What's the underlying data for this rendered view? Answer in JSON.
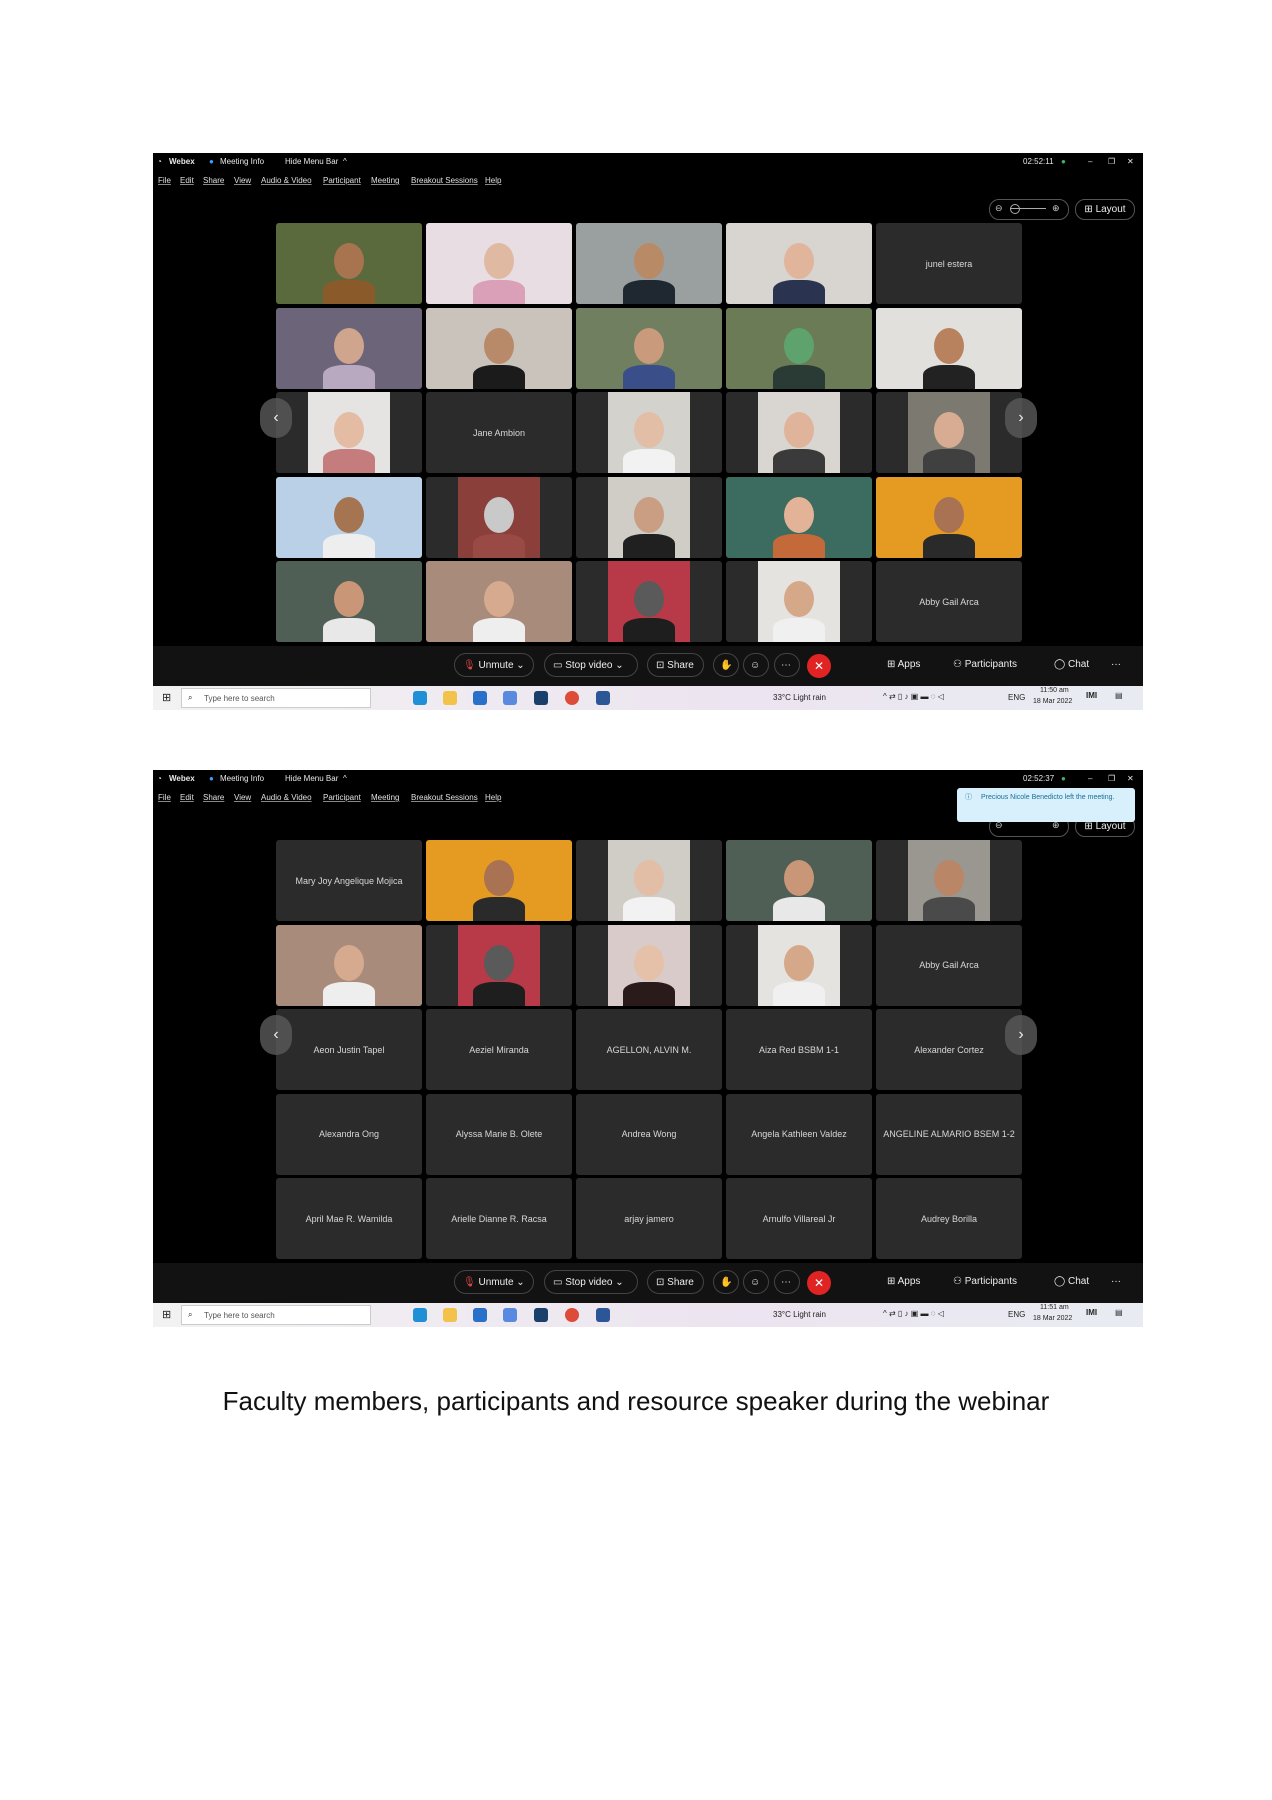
{
  "caption": "Faculty members, participants and resource speaker during the webinar",
  "screens": [
    {
      "title": {
        "app": "Webex",
        "meeting_info": "Meeting Info",
        "hide_menu": "Hide Menu Bar",
        "timer": "02:52:11"
      },
      "menu": [
        "File",
        "Edit",
        "Share",
        "View",
        "Audio & Video",
        "Participant",
        "Meeting",
        "Breakout Sessions",
        "Help"
      ],
      "layout_label": "Layout",
      "toolbar": {
        "unmute": "Unmute",
        "stop_video": "Stop video",
        "share": "Share",
        "apps": "Apps",
        "participants": "Participants",
        "chat": "Chat",
        "more": "···"
      },
      "taskbar": {
        "search_placeholder": "Type here to search",
        "weather": "33°C  Light rain",
        "lang": "ENG",
        "time": "11:50 am",
        "date": "18 Mar 2022"
      },
      "tiles": [
        {
          "kind": "video",
          "bg": "#5b6a3c",
          "skin": "#a7744f",
          "shirt": "#8b5a2b"
        },
        {
          "kind": "video",
          "bg": "#e8dde2",
          "skin": "#e0b9a3",
          "shirt": "#d9a0b8"
        },
        {
          "kind": "video",
          "bg": "#9aa0a0",
          "skin": "#b98a66",
          "shirt": "#1f2730"
        },
        {
          "kind": "video",
          "bg": "#d8d4d0",
          "skin": "#e1b59c",
          "shirt": "#2a3350"
        },
        {
          "kind": "name",
          "name": "junel estera"
        },
        {
          "kind": "video",
          "bg": "#6c6478",
          "skin": "#d0a58d",
          "shirt": "#b8a8c0"
        },
        {
          "kind": "video",
          "bg": "#c9c3bc",
          "skin": "#b88a6a",
          "shirt": "#1b1b1b"
        },
        {
          "kind": "video",
          "bg": "#6f7f60",
          "skin": "#c99a7b",
          "shirt": "#3a4f8a"
        },
        {
          "kind": "video",
          "bg": "#6a7b55",
          "skin": "#5ea36d",
          "shirt": "#2a3a35"
        },
        {
          "kind": "video",
          "bg": "#e2e0dc",
          "skin": "#b8825f",
          "shirt": "#222222"
        },
        {
          "kind": "portrait",
          "bg": "#e6e4e2",
          "skin": "#e4bca3",
          "shirt": "#c47c7c"
        },
        {
          "kind": "name",
          "name": "Jane Ambion"
        },
        {
          "kind": "portrait",
          "bg": "#d4d2cc",
          "skin": "#e2bea6",
          "shirt": "#f2f2f2"
        },
        {
          "kind": "portrait",
          "bg": "#d9d6d2",
          "skin": "#e0b49a",
          "shirt": "#3a3a3a"
        },
        {
          "kind": "portrait",
          "bg": "#7c7a70",
          "skin": "#d7ac92",
          "shirt": "#404040"
        },
        {
          "kind": "video",
          "bg": "#b9d0e6",
          "skin": "#a57552",
          "shirt": "#eeeeee"
        },
        {
          "kind": "portrait",
          "bg": "#8a3f3a",
          "skin": "#c9c9c9",
          "shirt": "#9a4a44"
        },
        {
          "kind": "portrait",
          "bg": "#d0ccc6",
          "skin": "#c99e83",
          "shirt": "#202020"
        },
        {
          "kind": "video",
          "bg": "#3c6b60",
          "skin": "#e3b397",
          "shirt": "#c46a3a"
        },
        {
          "kind": "video",
          "bg": "#e59a22",
          "skin": "#a87253",
          "shirt": "#2a2a2a"
        },
        {
          "kind": "video",
          "bg": "#4f5f55",
          "skin": "#c99777",
          "shirt": "#e8e8e8"
        },
        {
          "kind": "video",
          "bg": "#a88b7a",
          "skin": "#d5aa8e",
          "shirt": "#eeeeee"
        },
        {
          "kind": "portrait",
          "bg": "#b83a48",
          "skin": "#5a5a5a",
          "shirt": "#1e1e1e"
        },
        {
          "kind": "portrait",
          "bg": "#e5e3df",
          "skin": "#d6a88a",
          "shirt": "#f0f0f0"
        },
        {
          "kind": "name",
          "name": "Abby Gail Arca"
        }
      ]
    },
    {
      "title": {
        "app": "Webex",
        "meeting_info": "Meeting Info",
        "hide_menu": "Hide Menu Bar",
        "timer": "02:52:37"
      },
      "menu": [
        "File",
        "Edit",
        "Share",
        "View",
        "Audio & Video",
        "Participant",
        "Meeting",
        "Breakout Sessions",
        "Help"
      ],
      "layout_label": "Layout",
      "toast": "Precious Nicole Benedicto left the meeting.",
      "toolbar": {
        "unmute": "Unmute",
        "stop_video": "Stop video",
        "share": "Share",
        "apps": "Apps",
        "participants": "Participants",
        "chat": "Chat",
        "more": "···"
      },
      "taskbar": {
        "search_placeholder": "Type here to search",
        "weather": "33°C  Light rain",
        "lang": "ENG",
        "time": "11:51 am",
        "date": "18 Mar 2022"
      },
      "tiles": [
        {
          "kind": "name",
          "name": "Mary Joy Angelique Mojica"
        },
        {
          "kind": "video",
          "bg": "#e59a22",
          "skin": "#a87253",
          "shirt": "#2a2a2a"
        },
        {
          "kind": "portrait",
          "bg": "#d0ccc6",
          "skin": "#e2bea6",
          "shirt": "#f2f2f2"
        },
        {
          "kind": "video",
          "bg": "#4f5f55",
          "skin": "#c99777",
          "shirt": "#e8e8e8"
        },
        {
          "kind": "portrait",
          "bg": "#9a9690",
          "skin": "#b98668",
          "shirt": "#4a4a4a"
        },
        {
          "kind": "video",
          "bg": "#a88b7a",
          "skin": "#d5aa8e",
          "shirt": "#eeeeee"
        },
        {
          "kind": "portrait",
          "bg": "#b83a48",
          "skin": "#5a5a5a",
          "shirt": "#1e1e1e"
        },
        {
          "kind": "portrait",
          "bg": "#d9cbc9",
          "skin": "#e6c1a9",
          "shirt": "#2a1a1a"
        },
        {
          "kind": "portrait",
          "bg": "#e5e3df",
          "skin": "#d6a88a",
          "shirt": "#f0f0f0"
        },
        {
          "kind": "name",
          "name": "Abby Gail Arca"
        },
        {
          "kind": "name",
          "name": "Aeon Justin Tapel"
        },
        {
          "kind": "name",
          "name": "Aeziel Miranda"
        },
        {
          "kind": "name",
          "name": "AGELLON, ALVIN M."
        },
        {
          "kind": "name",
          "name": "Aiza Red BSBM 1-1"
        },
        {
          "kind": "name",
          "name": "Alexander Cortez"
        },
        {
          "kind": "name",
          "name": "Alexandra Ong"
        },
        {
          "kind": "name",
          "name": "Alyssa Marie B. Olete"
        },
        {
          "kind": "name",
          "name": "Andrea Wong"
        },
        {
          "kind": "name",
          "name": "Angela Kathleen Valdez"
        },
        {
          "kind": "name",
          "name": "ANGELINE ALMARIO BSEM 1-2"
        },
        {
          "kind": "name",
          "name": "April Mae R. Wamilda"
        },
        {
          "kind": "name",
          "name": "Arielle Dianne R. Racsa"
        },
        {
          "kind": "name",
          "name": "arjay jamero"
        },
        {
          "kind": "name",
          "name": "Arnulfo Villareal Jr"
        },
        {
          "kind": "name",
          "name": "Audrey Borilla"
        }
      ]
    }
  ]
}
